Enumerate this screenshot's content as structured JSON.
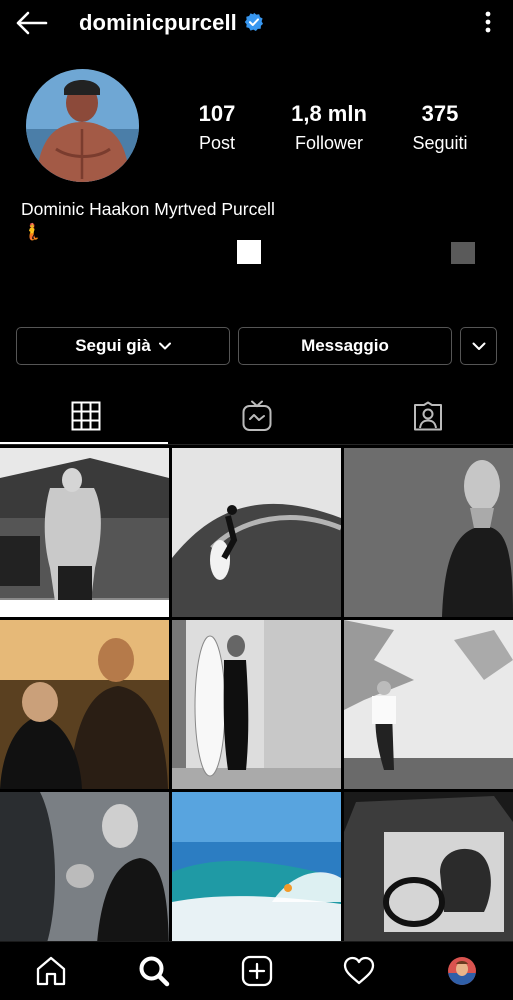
{
  "header": {
    "username": "dominicpurcell",
    "back_icon": "arrow-left-icon",
    "verified_icon": "verified-badge-icon",
    "verified_color": "#3897f0",
    "more_icon": "more-vertical-icon"
  },
  "profile": {
    "stats": [
      {
        "value": "107",
        "label": "Post"
      },
      {
        "value": "1,8 mln",
        "label": "Follower"
      },
      {
        "value": "375",
        "label": "Seguiti"
      }
    ],
    "full_name": "Dominic Haakon Myrtved Purcell",
    "bio_emoji": "🧜"
  },
  "actions": {
    "follow_label": "Segui già",
    "message_label": "Messaggio",
    "dropdown_icon": "chevron-down-icon"
  },
  "tabs": [
    {
      "name": "grid",
      "icon": "grid-icon",
      "active": true
    },
    {
      "name": "igtv",
      "icon": "igtv-icon",
      "active": false
    },
    {
      "name": "tagged",
      "icon": "tagged-person-icon",
      "active": false
    }
  ],
  "posts": [
    {
      "subject": "man outdoors on porch"
    },
    {
      "subject": "surfer on wave"
    },
    {
      "subject": "bald man portrait"
    },
    {
      "subject": "two men scene"
    },
    {
      "subject": "man beside surfboard"
    },
    {
      "subject": "man against wall"
    },
    {
      "subject": "boxing punching bag"
    },
    {
      "subject": "surfer in blue wave"
    },
    {
      "subject": "man driving vehicle"
    }
  ],
  "bottom_nav": [
    {
      "name": "home",
      "icon": "home-icon"
    },
    {
      "name": "search",
      "icon": "search-icon"
    },
    {
      "name": "new-post",
      "icon": "add-square-icon"
    },
    {
      "name": "activity",
      "icon": "heart-icon"
    },
    {
      "name": "profile",
      "icon": "profile-avatar-icon"
    }
  ]
}
